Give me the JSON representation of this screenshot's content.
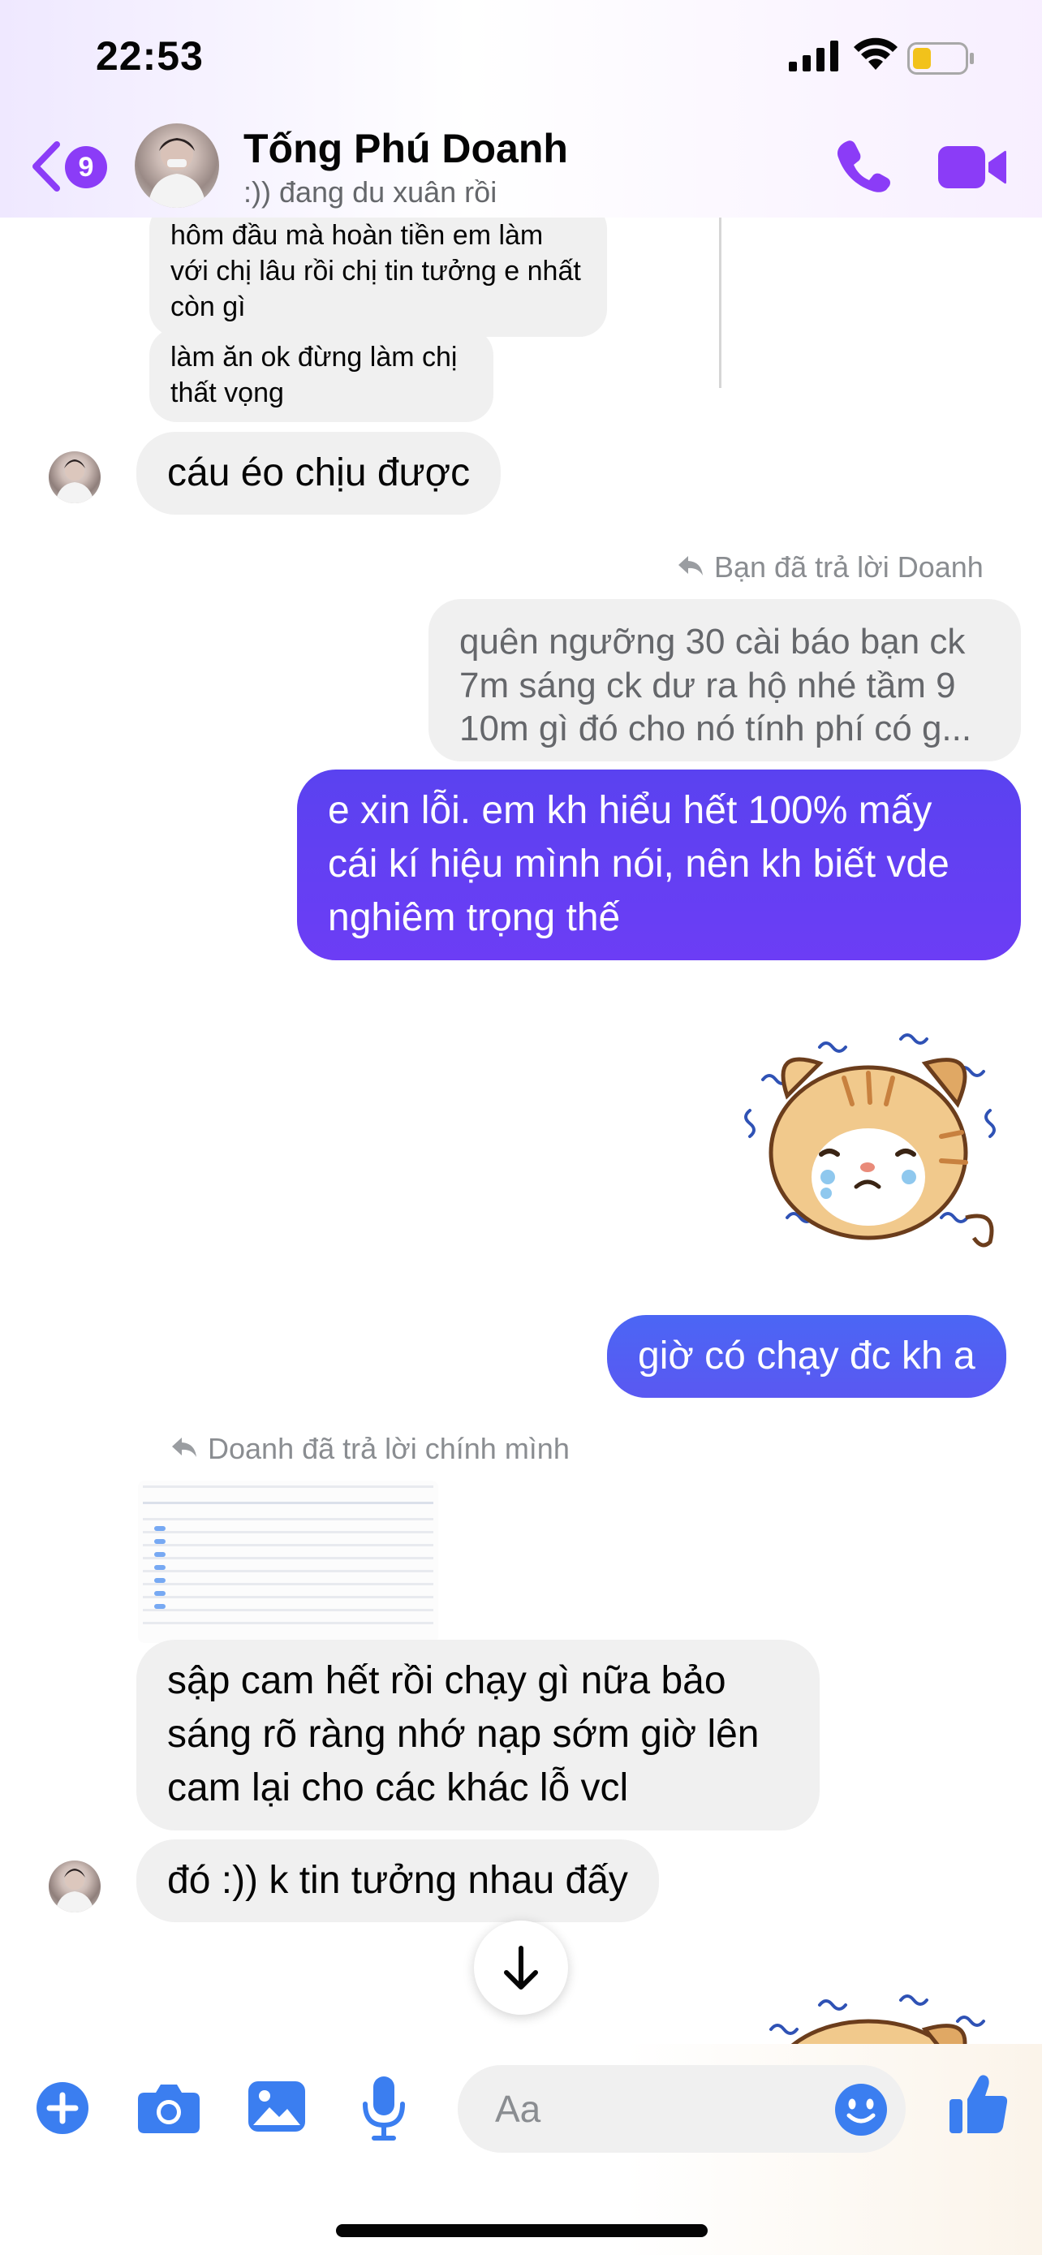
{
  "status_bar": {
    "time": "22:53"
  },
  "header": {
    "unread_count": "9",
    "contact_name": "Tống Phú Doanh",
    "contact_status": ":)) đang du xuân rồi"
  },
  "messages": {
    "m1": "hôm đầu mà hoàn tiền em làm với chị lâu rồi chị tin tưởng e nhất còn gì",
    "m2": "làm ăn ok đừng làm chị thất vọng",
    "m3": "cáu éo chịu được",
    "reply_label_1": "Bạn đã trả lời Doanh",
    "quoted_1": "quên ngưỡng 30 cài báo bạn ck 7m sáng ck dư ra hộ nhé tầm 9 10m gì đó cho nó tính phí có g...",
    "m4": "e xin lỗi. em kh hiểu hết 100% mấy cái kí hiệu mình nói, nên kh biết vde nghiêm trọng thế",
    "m5": "giờ có chạy đc kh a",
    "reply_label_2": "Doanh đã trả lời chính mình",
    "m6": "sập cam hết rồi chạy gì nữa bảo sáng rõ ràng nhớ nạp sớm giờ lên cam lại cho các khác lỗ vcl",
    "m7": "đó :)) k tin tưởng nhau đấy"
  },
  "composer": {
    "placeholder": "Aa"
  },
  "colors": {
    "accent": "#8b3cf7",
    "outgoing_bubble": "#5b42f0",
    "outgoing_bubble_light": "#4f6df5",
    "incoming_bubble": "#f0f0f0",
    "composer_icons": "#3b7ef0"
  },
  "icons": [
    "signal-icon",
    "wifi-icon",
    "battery-icon",
    "chevron-left-icon",
    "phone-icon",
    "video-camera-icon",
    "reply-arrow-icon",
    "arrow-down-icon",
    "plus-icon",
    "camera-icon",
    "image-icon",
    "microphone-icon",
    "emoji-icon",
    "thumbs-up-icon"
  ]
}
